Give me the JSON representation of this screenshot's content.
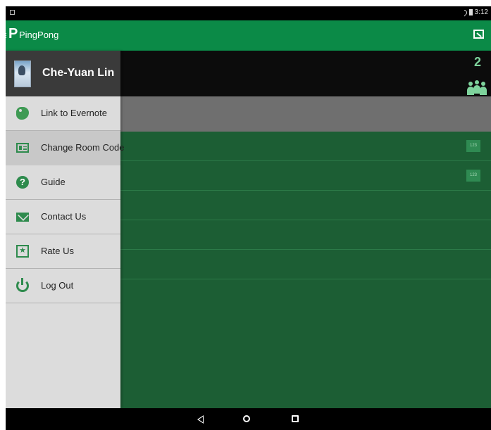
{
  "status_bar": {
    "time": "3:12"
  },
  "app_bar": {
    "title": "PingPong",
    "logo_letter": "P",
    "cast_icon": "cast-icon"
  },
  "main": {
    "participant_count": "2",
    "rows": [
      {
        "badge": "123"
      },
      {
        "badge": "123"
      }
    ]
  },
  "drawer": {
    "user_name": "Che-Yuan Lin",
    "items": [
      {
        "label": "Link to Evernote",
        "icon": "evernote-icon"
      },
      {
        "label": "Change Room Code",
        "icon": "id-card-icon",
        "selected": true
      },
      {
        "label": "Guide",
        "icon": "help-icon"
      },
      {
        "label": "Contact Us",
        "icon": "mail-icon"
      },
      {
        "label": "Rate Us",
        "icon": "star-icon"
      },
      {
        "label": "Log Out",
        "icon": "power-icon"
      }
    ]
  },
  "nav_bar": {
    "icons": [
      "back-icon",
      "home-icon",
      "recents-icon"
    ]
  },
  "colors": {
    "app_bar": "#0b8a47",
    "main_background": "#1c5e34",
    "drawer_background": "#dcdcdc",
    "icon_green": "#2e8b4d"
  }
}
